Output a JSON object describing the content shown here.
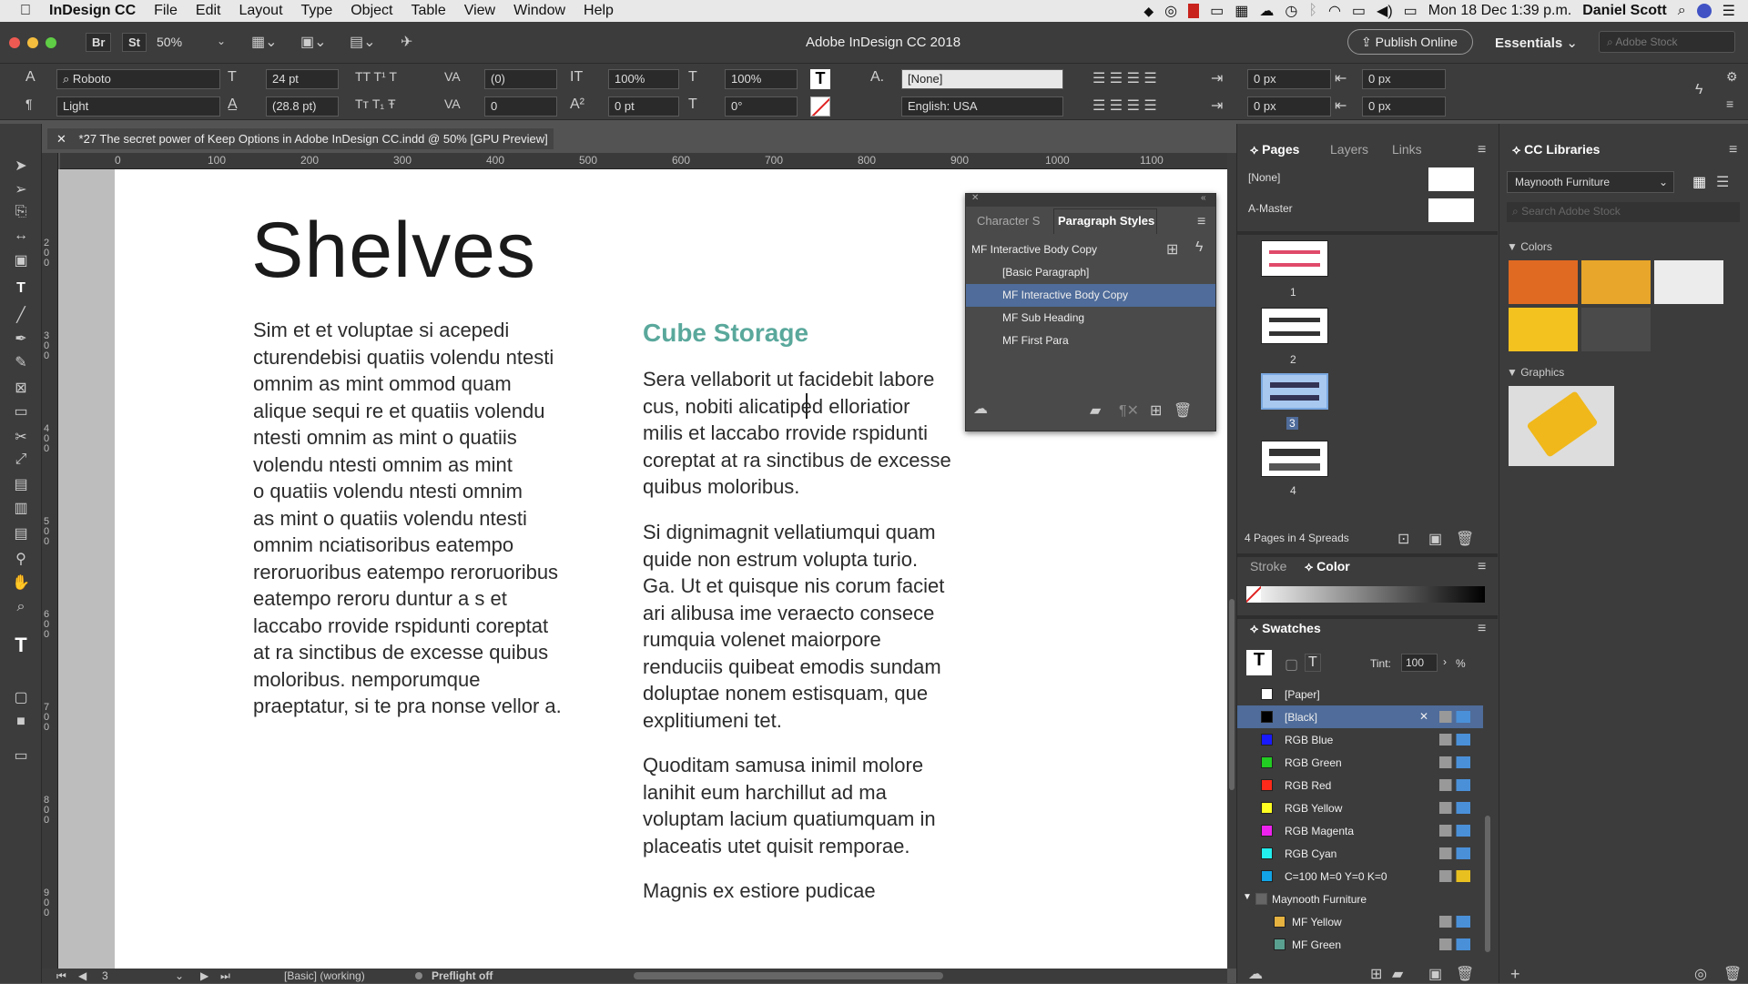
{
  "menubar": {
    "app_name": "InDesign CC",
    "items": [
      "File",
      "Edit",
      "Layout",
      "Type",
      "Object",
      "Table",
      "View",
      "Window",
      "Help"
    ],
    "clock": "Mon 18 Dec 1:39 p.m.",
    "user": "Daniel Scott"
  },
  "appbar": {
    "title": "Adobe InDesign CC 2018",
    "zoom": "50%",
    "br_label": "Br",
    "st_label": "St",
    "publish_label": "Publish Online",
    "workspace": "Essentials",
    "search_placeholder": "Adobe Stock"
  },
  "control": {
    "font": "Roboto",
    "style": "Light",
    "size": "24 pt",
    "leading": "(28.8 pt)",
    "kerning": "(0)",
    "tracking": "0",
    "vscale": "100%",
    "hscale": "100%",
    "baseline": "0 pt",
    "skew": "0°",
    "char_style": "[None]",
    "language": "English: USA",
    "indent1": "0 px",
    "indent2": "0 px",
    "indent3": "0 px",
    "indent4": "0 px"
  },
  "document": {
    "tab_title": "*27 The secret power of Keep Options in Adobe InDesign CC.indd @ 50% [GPU Preview]",
    "heading": "Shelves",
    "subheading": "Cube Storage",
    "col1": "Sim et et voluptae si acepedi\ncturendebisi quatiis volendu ntesti\nomnim as mint ommod quam\nalique sequi re et  quatiis volendu\nntesti omnim as mint o quatiis\nvolendu ntesti omnim as mint\no quatiis volendu ntesti omnim\nas mint o quatiis volendu ntesti\nomnim nciatisoribus eatempo\nreroruoribus eatempo reroruoribus\neatempo reroru duntur a s et\nlaccabo rrovide rspidunti coreptat\nat ra sinctibus de excesse quibus\nmoloribus. nemporumque\npraeptatur, si te pra nonse vellor a.",
    "para1": "Sera vellaborit ut facidebit labore\ncus, nobiti alicatiped elloriatior\nmilis et laccabo rrovide rspidunti\ncoreptat at ra sinctibus de excesse\nquibus moloribus.",
    "para2": "Si dignimagnit vellatiumqui quam\nquide non estrum volupta turio.\nGa. Ut et quisque nis corum faciet\nari alibusa ime veraecto consece\nrumquia volenet maiorpore\nrenduciis quibeat emodis sundam\ndoluptae nonem estisquam, que\nexplitiumeni tet.",
    "para3": "Quoditam samusa inimil molore\nlanihit eum harchillut ad ma\nvoluptam lacium quatiumquam in\nplaceatis utet quisit remporae.",
    "para4": "Magnis ex estiore pudicae"
  },
  "ruler": {
    "h_ticks": [
      "0",
      "100",
      "200",
      "300",
      "400",
      "500",
      "600",
      "700",
      "800",
      "900",
      "1000",
      "1100"
    ],
    "v_ticks": [
      "200",
      "300",
      "400",
      "500",
      "600",
      "700",
      "800",
      "900"
    ]
  },
  "status": {
    "page": "3",
    "style_state": "[Basic] (working)",
    "preflight": "Preflight off"
  },
  "paragraph_styles": {
    "tab_char": "Character S",
    "tab_para": "Paragraph Styles",
    "current": "MF Interactive Body Copy",
    "items": [
      "[Basic Paragraph]",
      "MF Interactive Body Copy",
      "MF Sub Heading",
      "MF First Para"
    ]
  },
  "pages_panel": {
    "tabs": [
      "Pages",
      "Layers",
      "Links"
    ],
    "none_label": "[None]",
    "master_label": "A-Master",
    "page_nums": [
      "1",
      "2",
      "3",
      "4"
    ],
    "summary": "4 Pages in 4 Spreads"
  },
  "color_panel": {
    "tab_stroke": "Stroke",
    "tab_color": "Color"
  },
  "swatches": {
    "title": "Swatches",
    "tint_label": "Tint:",
    "tint_value": "100",
    "pct": "%",
    "items": [
      {
        "name": "[Paper]",
        "color": "#ffffff"
      },
      {
        "name": "[Black]",
        "color": "#000000"
      },
      {
        "name": "RGB Blue",
        "color": "#1a1aff"
      },
      {
        "name": "RGB Green",
        "color": "#22cc22"
      },
      {
        "name": "RGB Red",
        "color": "#ff2a1a"
      },
      {
        "name": "RGB Yellow",
        "color": "#ffff22"
      },
      {
        "name": "RGB Magenta",
        "color": "#ee22ee"
      },
      {
        "name": "RGB Cyan",
        "color": "#22eeee"
      },
      {
        "name": "C=100 M=0 Y=0 K=0",
        "color": "#12a4e6"
      }
    ],
    "group_name": "Maynooth Furniture",
    "group_items": [
      {
        "name": "MF Yellow",
        "color": "#e6b240"
      },
      {
        "name": "MF Green",
        "color": "#5aa090"
      }
    ]
  },
  "cc_libraries": {
    "title": "CC Libraries",
    "library": "Maynooth Furniture",
    "search_placeholder": "Search Adobe Stock",
    "colors_label": "Colors",
    "graphics_label": "Graphics",
    "colors": [
      "#e06a22",
      "#e8a62a",
      "#ececec",
      "#f4c21e",
      "#4a4a4a"
    ]
  },
  "accent": {
    "heading_teal": "#5aa89c",
    "selection_blue": "#4f6c9a"
  }
}
